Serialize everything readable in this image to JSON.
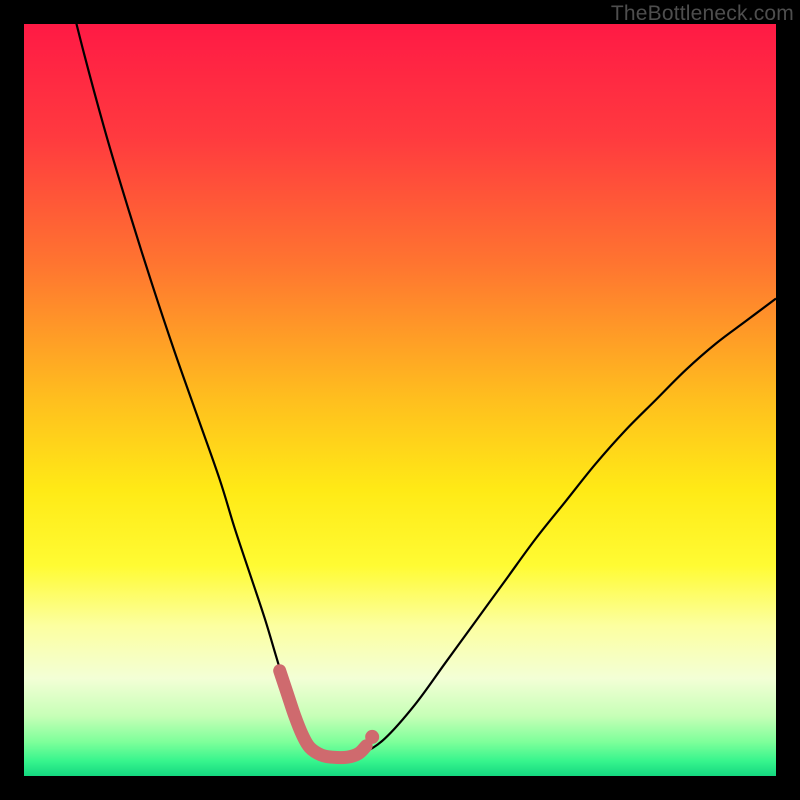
{
  "watermark": "TheBottleneck.com",
  "chart_data": {
    "type": "line",
    "title": "",
    "xlabel": "",
    "ylabel": "",
    "xlim": [
      0,
      100
    ],
    "ylim": [
      0,
      100
    ],
    "grid": false,
    "series": [
      {
        "name": "bottleneck-curve",
        "color": "#000000",
        "x": [
          5,
          8,
          11,
          14,
          17,
          20,
          23,
          26,
          28,
          30,
          32,
          33.5,
          35,
          36,
          37,
          38,
          39.5,
          41,
          43,
          45,
          48,
          52,
          56,
          60,
          64,
          68,
          72,
          76,
          80,
          84,
          88,
          92,
          96,
          100
        ],
        "y": [
          108,
          96,
          85,
          75,
          65.5,
          56.5,
          48,
          39.5,
          33,
          27,
          21,
          16,
          11,
          8,
          5.5,
          4,
          2.8,
          2.5,
          2.5,
          3,
          5,
          9.5,
          15,
          20.5,
          26,
          31.5,
          36.5,
          41.5,
          46,
          50,
          54,
          57.5,
          60.5,
          63.5
        ]
      },
      {
        "name": "highlight-segment",
        "color": "#cf6a6e",
        "x": [
          34,
          35,
          36,
          37,
          38,
          39.5,
          41,
          43,
          44.5,
          45.5
        ],
        "y": [
          14,
          11,
          8,
          5.5,
          3.8,
          2.8,
          2.5,
          2.5,
          3,
          4
        ]
      }
    ],
    "highlight_dot": {
      "x": 46.3,
      "y": 5.2,
      "color": "#cf6a6e"
    },
    "background_gradient": {
      "stops": [
        {
          "offset": 0.0,
          "color": "#ff1a45"
        },
        {
          "offset": 0.15,
          "color": "#ff3a3f"
        },
        {
          "offset": 0.32,
          "color": "#ff7530"
        },
        {
          "offset": 0.5,
          "color": "#ffbf1e"
        },
        {
          "offset": 0.62,
          "color": "#ffea16"
        },
        {
          "offset": 0.72,
          "color": "#fffb33"
        },
        {
          "offset": 0.8,
          "color": "#fcffa0"
        },
        {
          "offset": 0.87,
          "color": "#f3ffd6"
        },
        {
          "offset": 0.92,
          "color": "#c7ffb7"
        },
        {
          "offset": 0.955,
          "color": "#7dff9a"
        },
        {
          "offset": 0.98,
          "color": "#37f58d"
        },
        {
          "offset": 1.0,
          "color": "#14d880"
        }
      ]
    }
  }
}
